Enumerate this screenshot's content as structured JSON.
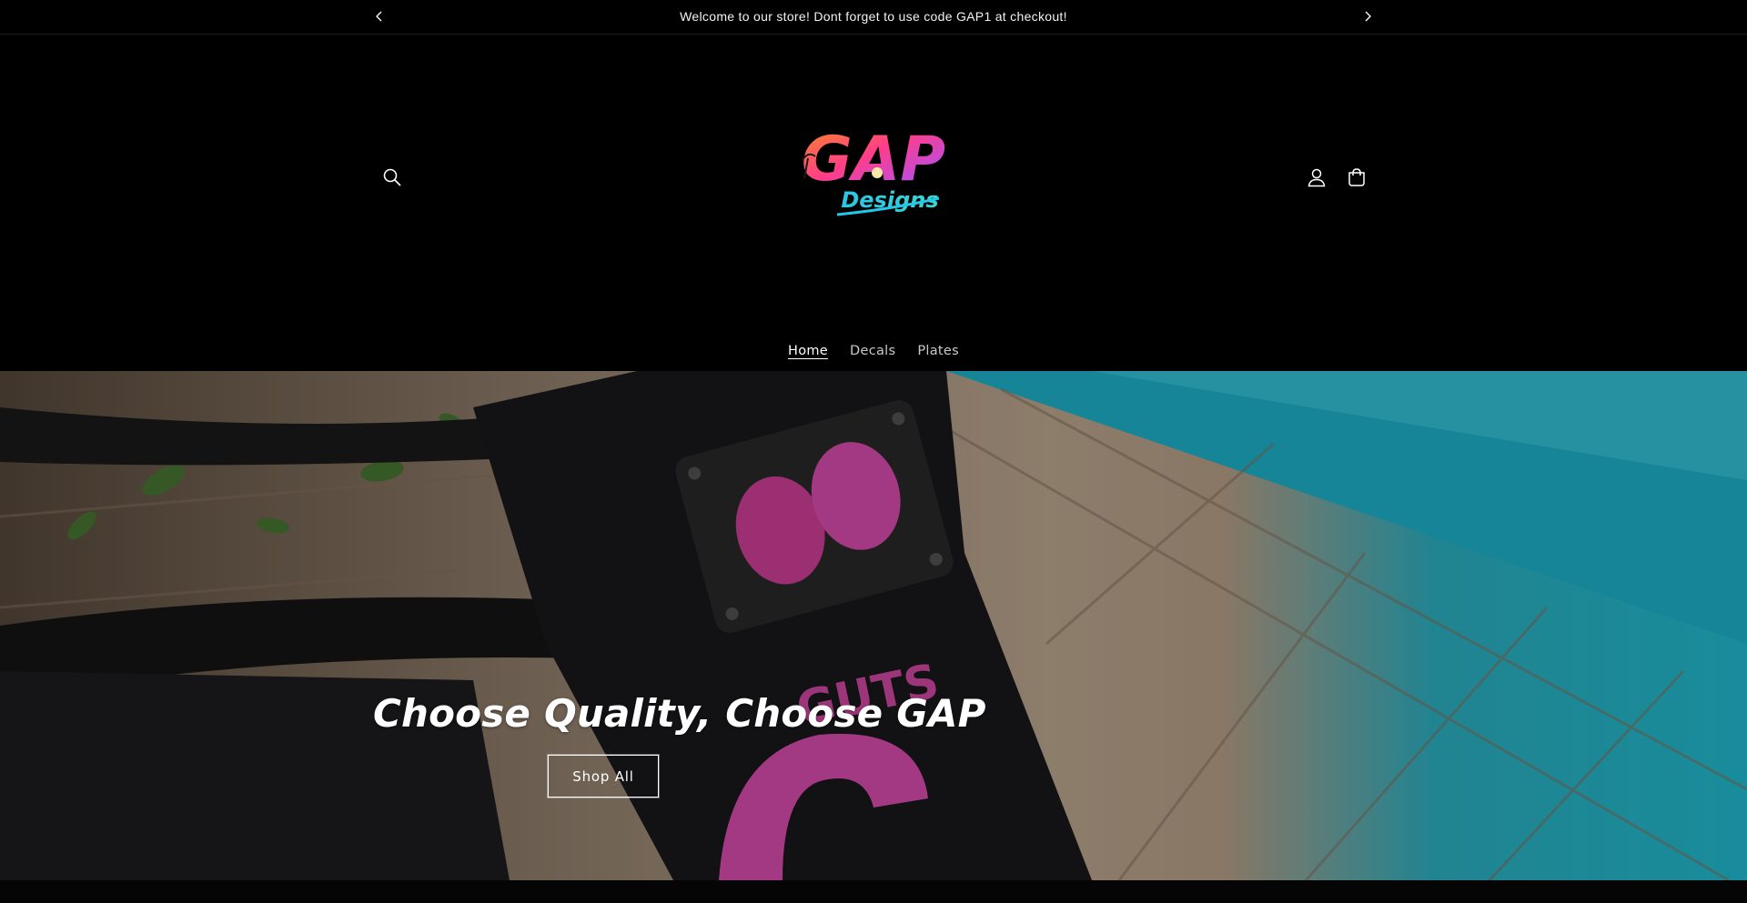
{
  "announcement": {
    "text": "Welcome to our store! Dont forget to use code GAP1 at checkout!"
  },
  "header": {
    "logo": {
      "main": "GAP",
      "sub": "Designs"
    }
  },
  "nav": {
    "items": [
      {
        "label": "Home",
        "active": true
      },
      {
        "label": "Decals",
        "active": false
      },
      {
        "label": "Plates",
        "active": false
      }
    ]
  },
  "hero": {
    "title": "Choose Quality, Choose GAP",
    "button_label": "Shop All",
    "decal_text": "GUTS"
  },
  "colors": {
    "background": "#000000",
    "text": "#ffffff",
    "pool": "#22c3d8",
    "pink": "#e24fb4"
  },
  "icons": [
    "chevron-left-icon",
    "chevron-right-icon",
    "search-icon",
    "account-icon",
    "cart-icon"
  ]
}
